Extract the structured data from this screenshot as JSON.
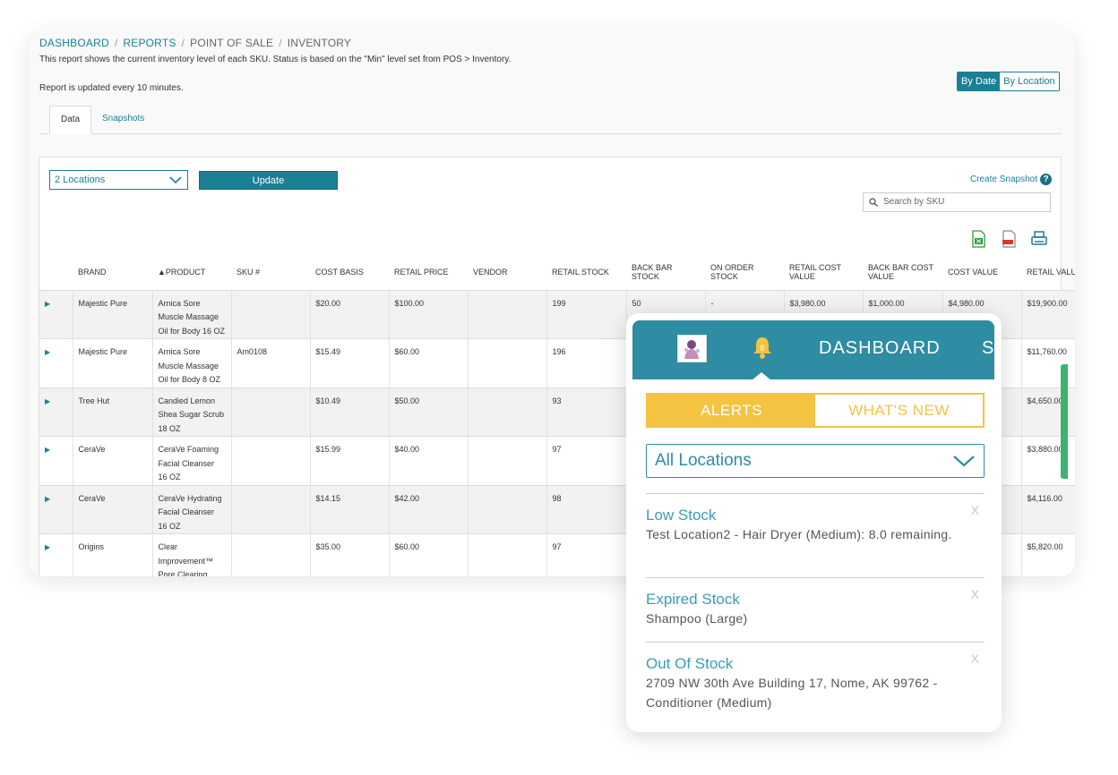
{
  "breadcrumb": [
    {
      "label": "DASHBOARD",
      "link": true
    },
    {
      "label": "REPORTS",
      "link": true
    },
    {
      "label": "POINT OF SALE",
      "link": false
    },
    {
      "label": "INVENTORY",
      "link": false
    }
  ],
  "description": "This report shows the current inventory level of each SKU. Status is based on the \"Min\" level set from POS > Inventory.",
  "update_note": "Report is updated every 10 minutes.",
  "view_toggle": {
    "by_date": "By Date",
    "by_location": "By Location"
  },
  "tabs": {
    "data": "Data",
    "snapshots": "Snapshots"
  },
  "controls": {
    "location_select": "2 Locations",
    "update_button": "Update",
    "create_snapshot": "Create Snapshot",
    "help_glyph": "?",
    "search_placeholder": "Search by SKU"
  },
  "table": {
    "columns": [
      "",
      "BRAND",
      "▲PRODUCT",
      "SKU #",
      "COST BASIS",
      "RETAIL PRICE",
      "VENDOR",
      "RETAIL STOCK",
      "BACK BAR STOCK",
      "ON ORDER STOCK",
      "RETAIL COST VALUE",
      "BACK BAR COST VALUE",
      "COST VALUE",
      "RETAIL VALUE"
    ],
    "rows": [
      {
        "brand": "Majestic Pure",
        "product": "Arnica Sore Muscle Massage Oil for Body 16 OZ",
        "sku": "",
        "cost_basis": "$20.00",
        "retail_price": "$100.00",
        "vendor": "",
        "retail_stock": "199",
        "back_bar_stock": "50",
        "on_order": "-",
        "retail_cost_value": "$3,980.00",
        "back_bar_cost_value": "$1,000.00",
        "cost_value": "$4,980.00",
        "retail_value": "$19,900.00"
      },
      {
        "brand": "Majestic Pure",
        "product": "Arnica Sore Muscle Massage Oil for Body 8 OZ",
        "sku": "Am0108",
        "cost_basis": "$15.49",
        "retail_price": "$60.00",
        "vendor": "",
        "retail_stock": "196",
        "back_bar_stock": "",
        "on_order": "",
        "retail_cost_value": "",
        "back_bar_cost_value": "",
        "cost_value": "",
        "retail_value": "$11,760.00"
      },
      {
        "brand": "Tree Hut",
        "product": "Candied Lemon Shea Sugar Scrub 18 OZ",
        "sku": "",
        "cost_basis": "$10.49",
        "retail_price": "$50.00",
        "vendor": "",
        "retail_stock": "93",
        "back_bar_stock": "",
        "on_order": "",
        "retail_cost_value": "",
        "back_bar_cost_value": "",
        "cost_value": "",
        "retail_value": "$4,650.00"
      },
      {
        "brand": "CeraVe",
        "product": "CeraVe Foaming Facial Cleanser 16 OZ",
        "sku": "",
        "cost_basis": "$15.99",
        "retail_price": "$40.00",
        "vendor": "",
        "retail_stock": "97",
        "back_bar_stock": "",
        "on_order": "",
        "retail_cost_value": "",
        "back_bar_cost_value": "",
        "cost_value": "",
        "retail_value": "$3,880.00"
      },
      {
        "brand": "CeraVe",
        "product": "CeraVe Hydrating Facial Cleanser 16 OZ",
        "sku": "",
        "cost_basis": "$14.15",
        "retail_price": "$42.00",
        "vendor": "",
        "retail_stock": "98",
        "back_bar_stock": "",
        "on_order": "",
        "retail_cost_value": "",
        "back_bar_cost_value": "",
        "cost_value": "",
        "retail_value": "$4,116.00"
      },
      {
        "brand": "Origins",
        "product": "Clear Improvement™ Pore Clearing",
        "sku": "",
        "cost_basis": "$35.00",
        "retail_price": "$60.00",
        "vendor": "",
        "retail_stock": "97",
        "back_bar_stock": "",
        "on_order": "",
        "retail_cost_value": "",
        "back_bar_cost_value": "",
        "cost_value": "",
        "retail_value": "$5,820.00"
      }
    ]
  },
  "popup": {
    "bell_count": "8",
    "title": "DASHBOARD",
    "title_cut": "S",
    "tabs": {
      "alerts": "ALERTS",
      "whats_new": "WHAT'S NEW"
    },
    "location_select": "All Locations",
    "dismiss_glyph": "X",
    "alerts": [
      {
        "title": "Low Stock",
        "body": "Test Location2 - Hair Dryer (Medium): 8.0 remaining."
      },
      {
        "title": "Expired Stock",
        "body": "Shampoo (Large)"
      },
      {
        "title": "Out Of Stock",
        "body": "2709 NW 30th Ave Building 17, Nome, AK 99762 - Conditioner (Medium)"
      }
    ]
  },
  "colors": {
    "accent": "#1b7f95",
    "popup_header": "#2e8ca3",
    "alert_yellow": "#f3c341",
    "alert_title": "#3a9cb5",
    "strip": "#3cb371"
  }
}
